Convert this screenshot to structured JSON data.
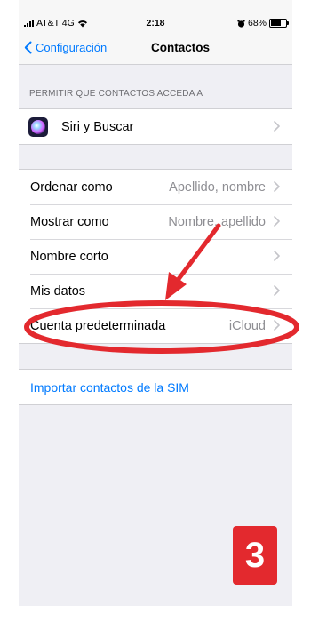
{
  "status_bar": {
    "carrier": "AT&T 4G",
    "time": "2:18",
    "battery": "68%",
    "battery_level": 0.68
  },
  "nav": {
    "back_label": "Configuración",
    "title": "Contactos"
  },
  "section_header": "PERMITIR QUE CONTACTOS ACCEDA A",
  "siri_row": {
    "label": "Siri y Buscar"
  },
  "settings_rows": [
    {
      "label": "Ordenar como",
      "value": "Apellido, nombre"
    },
    {
      "label": "Mostrar como",
      "value": "Nombre, apellido"
    },
    {
      "label": "Nombre corto",
      "value": ""
    },
    {
      "label": "Mis datos",
      "value": ""
    },
    {
      "label": "Cuenta predeterminada",
      "value": "iCloud"
    }
  ],
  "import_row": {
    "label": "Importar contactos de la SIM"
  },
  "annotation": {
    "step_number": "3",
    "highlight_color": "#e3292e",
    "link_color": "#007aff"
  }
}
